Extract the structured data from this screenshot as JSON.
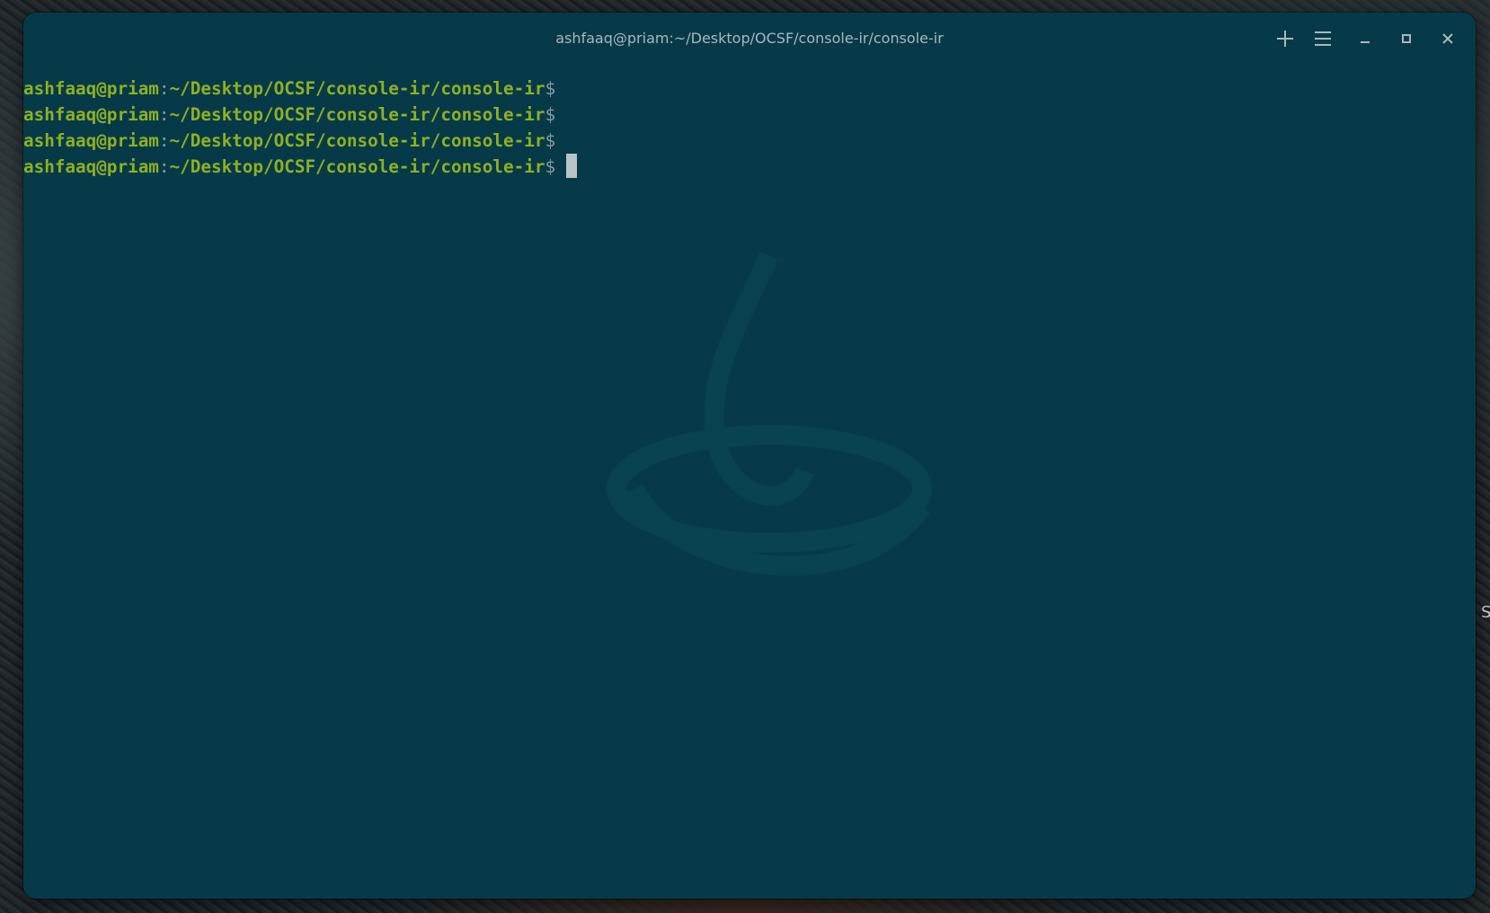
{
  "window": {
    "title": "ashfaaq@priam:~/Desktop/OCSF/console-ir/console-ir"
  },
  "titlebar": {
    "new_tab_icon": "plus-icon",
    "menu_icon": "hamburger-menu-icon",
    "minimize_icon": "minimize-icon",
    "maximize_icon": "maximize-icon",
    "close_icon": "close-icon"
  },
  "terminal": {
    "lines": [
      {
        "user_host": "ashfaaq@priam",
        "colon": ":",
        "path": "~/Desktop/OCSF/console-ir/console-ir",
        "prompt": "$"
      },
      {
        "user_host": "ashfaaq@priam",
        "colon": ":",
        "path": "~/Desktop/OCSF/console-ir/console-ir",
        "prompt": "$"
      },
      {
        "user_host": "ashfaaq@priam",
        "colon": ":",
        "path": "~/Desktop/OCSF/console-ir/console-ir",
        "prompt": "$"
      },
      {
        "user_host": "ashfaaq@priam",
        "colon": ":",
        "path": "~/Desktop/OCSF/console-ir/console-ir",
        "prompt": "$"
      }
    ],
    "colors": {
      "background": "#063a49",
      "prompt_user": "#8fb022",
      "prompt_symbol": "#8a9aa0",
      "cursor": "#b8c4c8"
    }
  },
  "desktop": {
    "edge_text": "S"
  }
}
